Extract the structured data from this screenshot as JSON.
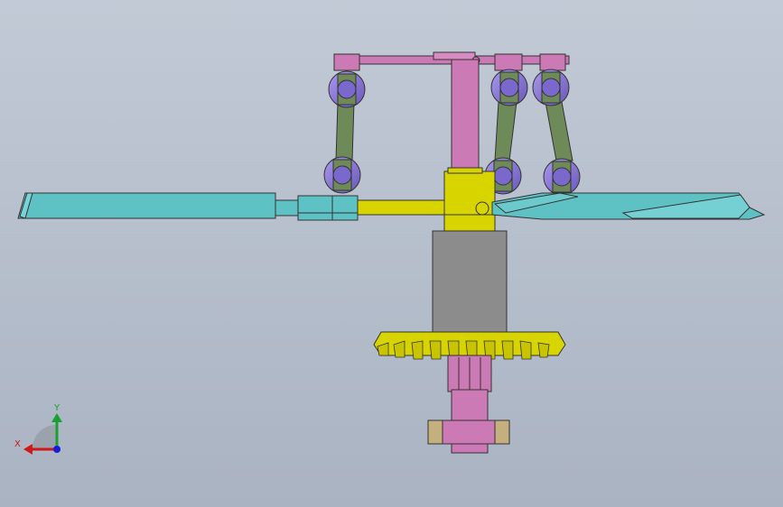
{
  "viewport": {
    "background_top": "#c2cad6",
    "background_bottom": "#aab3c2"
  },
  "triad": {
    "x_label": "X",
    "y_label": "Y",
    "x_color": "#d01818",
    "y_color": "#18a030",
    "z_color": "#1a1ad8"
  },
  "colors": {
    "pink": "#cc7ab6",
    "purple": "#8a76d6",
    "olive_green": "#6e8a58",
    "yellow": "#d8d400",
    "teal": "#5ec2c4",
    "gray": "#8c8c8c",
    "tan": "#c4b07e"
  }
}
